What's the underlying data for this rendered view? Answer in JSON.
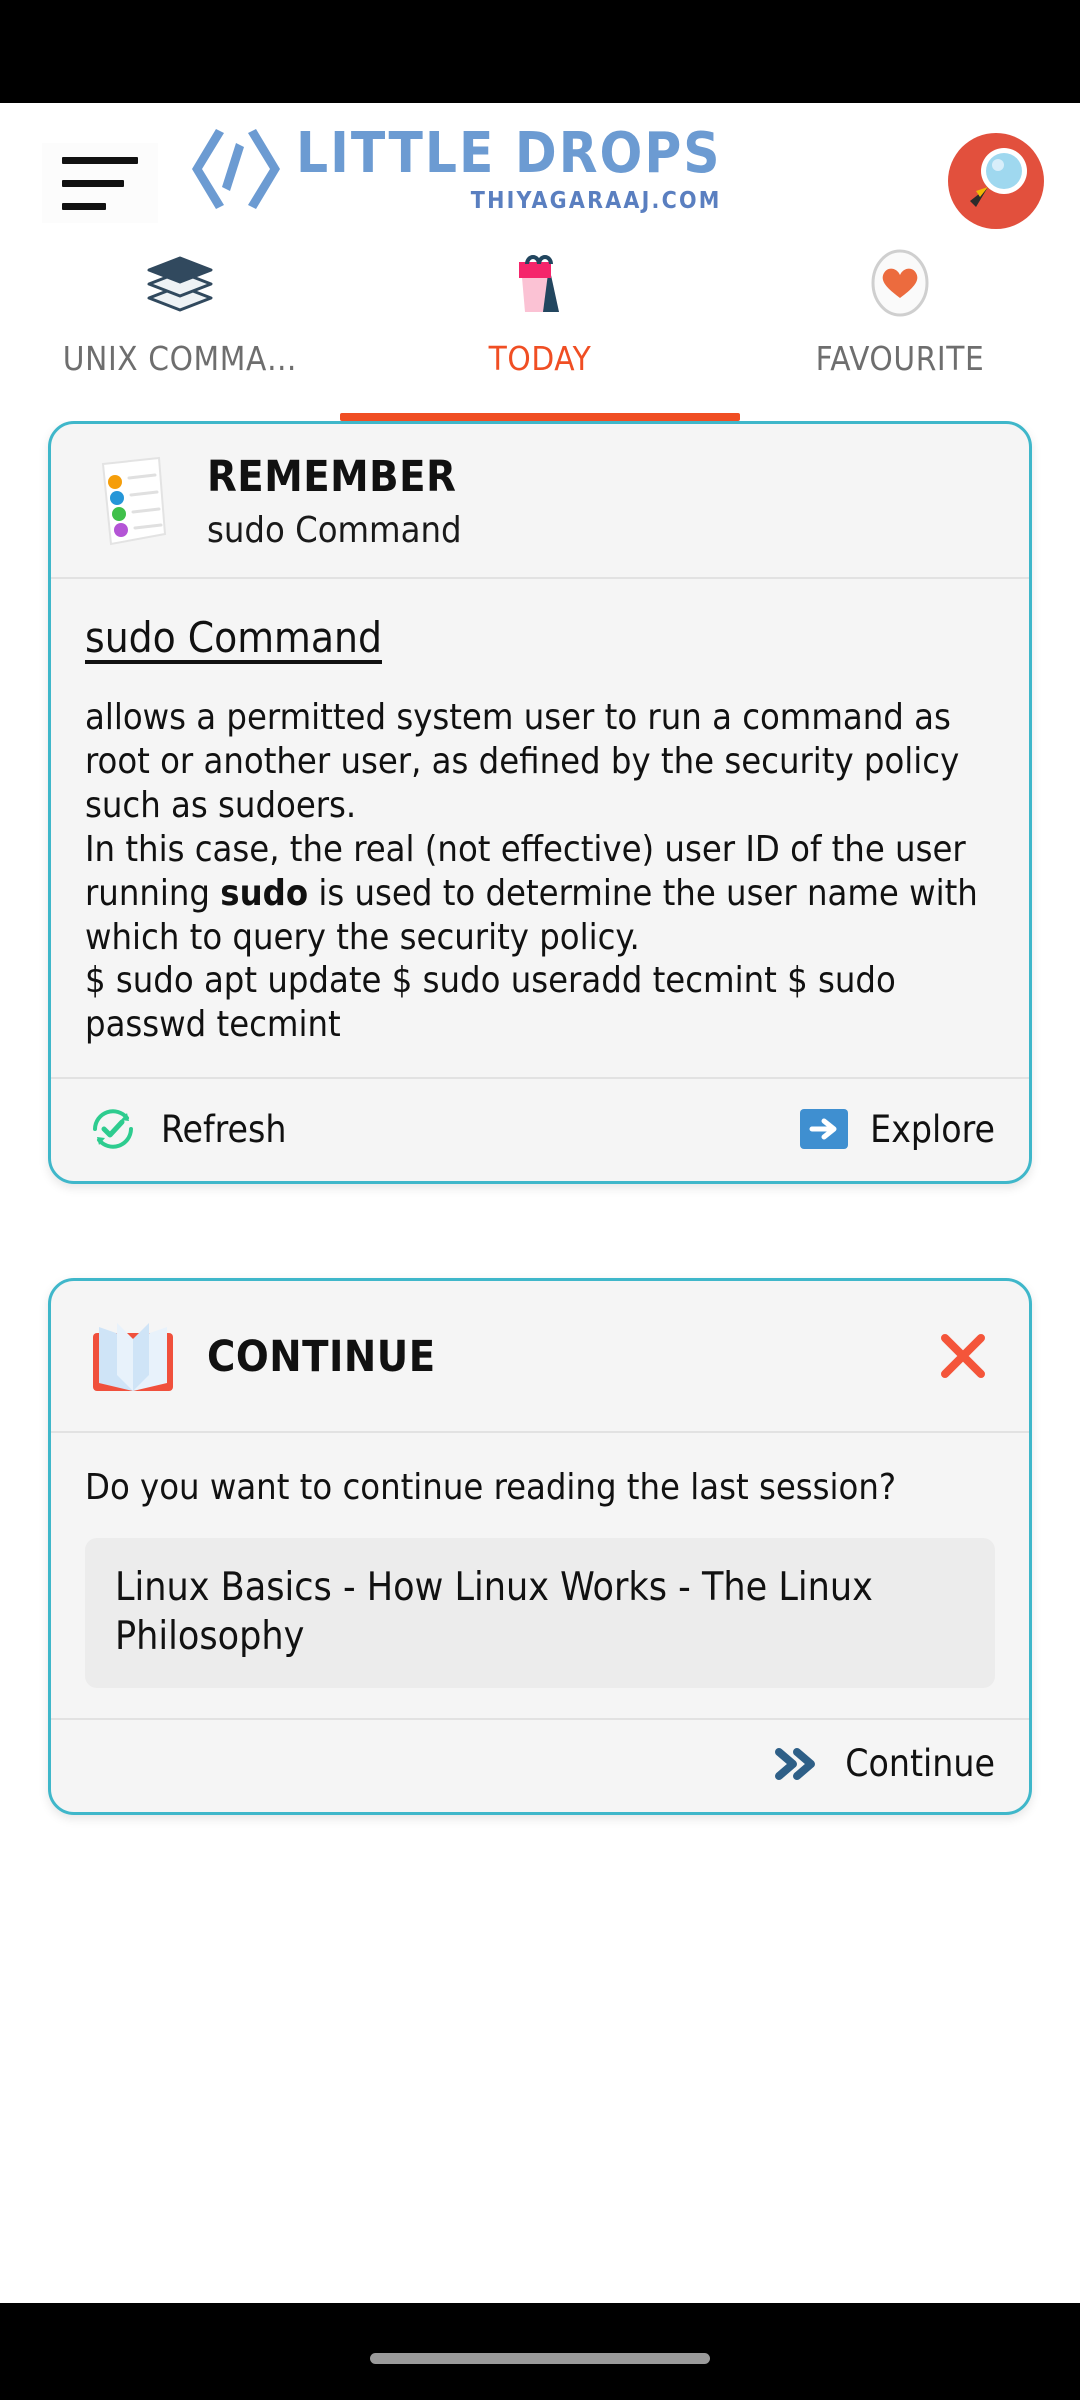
{
  "header": {
    "menu_icon": "hamburger-menu-icon",
    "logo_title": "LITTLE DROPS",
    "logo_subtitle": "THIYAGARAAJ.COM",
    "logo_mark_icon": "code-brackets-logo-icon",
    "search_icon": "magnifier-search-icon"
  },
  "tabs": [
    {
      "label": "UNIX COMMA…",
      "icon": "stacked-books-icon",
      "active": false
    },
    {
      "label": "TODAY",
      "icon": "calendar-bag-icon",
      "active": true
    },
    {
      "label": "FAVOURITE",
      "icon": "heart-oval-icon",
      "active": false
    }
  ],
  "cards": {
    "remember": {
      "icon": "checklist-note-icon",
      "title": "REMEMBER",
      "subtitle": "sudo Command",
      "body_heading": "sudo Command",
      "body_line1": "allows a permitted system user to run a command as root or another user, as defined by the security policy such as sudoers.",
      "body_line2_pre": "In this case, the real (not effective) user ID of the user running ",
      "body_line2_bold": "sudo",
      "body_line2_post": " is used to determine the user name with which to query the security policy.",
      "body_line3": "$ sudo apt update $ sudo useradd tecmint $ sudo passwd tecmint",
      "refresh_label": "Refresh",
      "refresh_icon": "refresh-check-icon",
      "explore_label": "Explore",
      "explore_icon": "arrow-right-square-icon"
    },
    "continue": {
      "icon": "open-book-icon",
      "title": "CONTINUE",
      "close_icon": "close-x-icon",
      "question": "Do you want to continue reading the last session?",
      "last_title": "Linux Basics - How Linux Works - The Linux Philosophy",
      "continue_label": "Continue",
      "continue_icon": "double-chevron-right-icon"
    }
  },
  "colors": {
    "accent_orange": "#f04e23",
    "card_border_teal": "#3fb7ca",
    "logo_blue": "#6c9bd2",
    "refresh_green": "#2ecc8f",
    "explore_blue": "#3f8fd0"
  }
}
